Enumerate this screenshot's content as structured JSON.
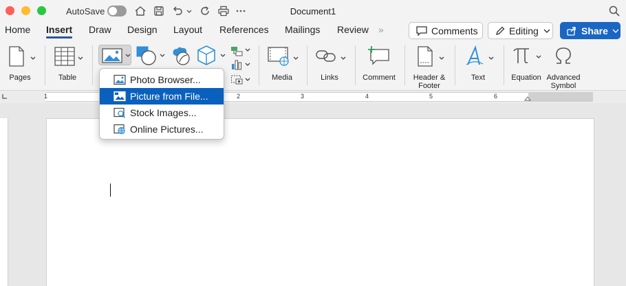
{
  "window": {
    "title": "Document1",
    "autosave_label": "AutoSave",
    "autosave_on": false,
    "traffic_lights": {
      "close": "#ff5f57",
      "minimize": "#febc2e",
      "zoom": "#28c840"
    },
    "quick_access_icons": [
      "home-icon",
      "save-icon",
      "undo-icon",
      "redo-icon",
      "print-icon",
      "more-icon"
    ]
  },
  "tabs": [
    {
      "label": "Home",
      "active": false
    },
    {
      "label": "Insert",
      "active": true
    },
    {
      "label": "Draw",
      "active": false
    },
    {
      "label": "Design",
      "active": false
    },
    {
      "label": "Layout",
      "active": false
    },
    {
      "label": "References",
      "active": false
    },
    {
      "label": "Mailings",
      "active": false
    },
    {
      "label": "Review",
      "active": false
    }
  ],
  "tab_overflow": "»",
  "toolbar": {
    "comments_label": "Comments",
    "editing_label": "Editing",
    "share_label": "Share",
    "accent_color": "#1a66c2"
  },
  "ribbon": {
    "pages": "Pages",
    "table": "Table",
    "media": "Media",
    "links": "Links",
    "comment": "Comment",
    "header_footer": "Header &\nFooter",
    "header_footer_line1": "Header &",
    "header_footer_line2": "Footer",
    "text": "Text",
    "equation": "Equation",
    "advanced_symbol_line1": "Advanced",
    "advanced_symbol_line2": "Symbol"
  },
  "ruler": {
    "numbers": [
      "1",
      "2",
      "3",
      "4",
      "5",
      "6",
      "7"
    ]
  },
  "picture_menu": {
    "items": [
      {
        "label": "Photo Browser...",
        "icon": "photo-browser-icon",
        "selected": false
      },
      {
        "label": "Picture from File...",
        "icon": "picture-file-icon",
        "selected": true
      },
      {
        "label": "Stock Images...",
        "icon": "stock-images-icon",
        "selected": false
      },
      {
        "label": "Online Pictures...",
        "icon": "online-pictures-icon",
        "selected": false
      }
    ],
    "highlight_color": "#0a60bd"
  }
}
